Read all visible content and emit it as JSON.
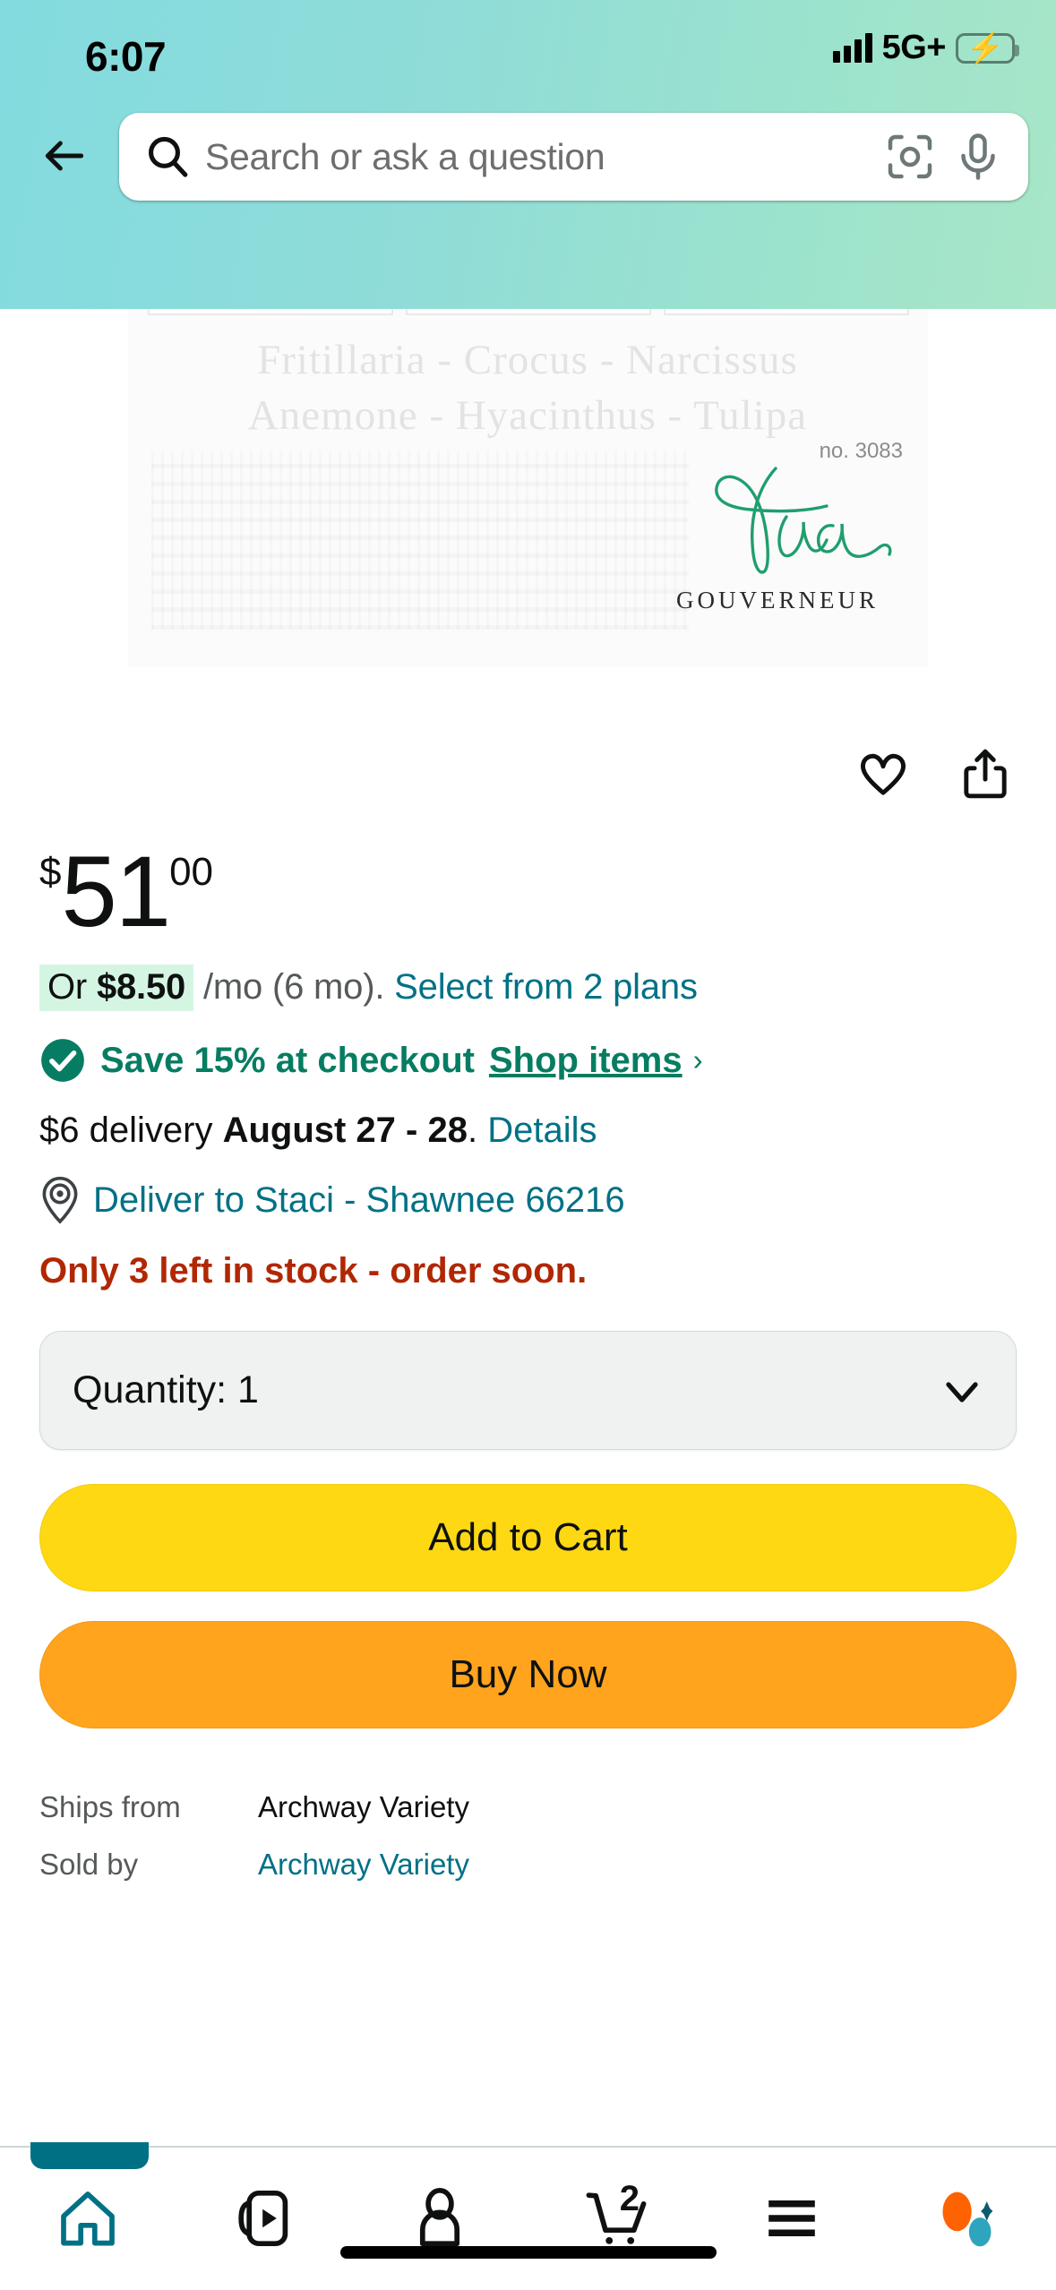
{
  "status_bar": {
    "time": "6:07",
    "network": "5G+",
    "signal_icon": "signal-bars-icon",
    "battery_icon": "battery-charging-icon",
    "battery_color": "#2fd158"
  },
  "header": {
    "background_color": "#8fdcd8",
    "back_icon": "back-arrow-icon",
    "search": {
      "placeholder": "Search or ask a question",
      "search_icon": "search-icon",
      "camera_icon": "camera-lens-icon",
      "mic_icon": "microphone-icon"
    }
  },
  "product_image": {
    "brand_script": "thea",
    "brand_sub": "GOUVERNEUR",
    "item_number": "no. 3083",
    "botanical_line_1": "Fritillaria  -  Crocus  -  Narcissus",
    "botanical_line_2": "Anemone  -  Hyacinthus  -  Tulipa",
    "brand_color": "#1f9e6e"
  },
  "actions": {
    "wishlist_icon": "heart-icon",
    "share_icon": "share-icon"
  },
  "price": {
    "symbol": "$",
    "whole": "51",
    "fraction": "00"
  },
  "installment": {
    "prefix": "Or ",
    "amount": "$8.50",
    "terms": " /mo (6 mo). ",
    "link": "Select from 2 plans",
    "highlight_color": "#d5f5e3",
    "link_color": "#007185"
  },
  "promo": {
    "check_icon": "check-circle-icon",
    "text": "Save 15% at checkout",
    "link": "Shop items",
    "chevron": "›",
    "color": "#067d62"
  },
  "delivery": {
    "prefix": "$6 delivery ",
    "date": "August 27 - 28",
    "suffix": ". ",
    "details_link": "Details"
  },
  "deliver_to": {
    "pin_icon": "location-pin-icon",
    "text": "Deliver to Staci - Shawnee 66216",
    "color": "#007185"
  },
  "stock": {
    "text": "Only 3 left in stock - order soon.",
    "color": "#b12704"
  },
  "quantity": {
    "label": "Quantity:  1",
    "chevron_icon": "chevron-down-icon"
  },
  "buttons": {
    "add_to_cart": "Add to Cart",
    "add_to_cart_color": "#ffd814",
    "buy_now": "Buy Now",
    "buy_now_color": "#ffa41c"
  },
  "seller_info": {
    "rows": [
      {
        "key": "Ships from",
        "value": "Archway Variety",
        "is_link": false
      },
      {
        "key": "Sold by",
        "value": "Archway Variety",
        "is_link": true
      }
    ]
  },
  "bottom_nav": {
    "items": [
      {
        "name": "home",
        "icon": "home-icon",
        "active": true
      },
      {
        "name": "video",
        "icon": "video-shorts-icon",
        "active": false
      },
      {
        "name": "account",
        "icon": "person-icon",
        "active": false
      },
      {
        "name": "cart",
        "icon": "shopping-cart-icon",
        "badge": "2",
        "active": false
      },
      {
        "name": "menu",
        "icon": "hamburger-menu-icon",
        "active": false
      },
      {
        "name": "rufus",
        "icon": "rufus-assistant-icon",
        "active": false
      }
    ],
    "active_color": "#007185",
    "rufus_orange": "#ff6200",
    "rufus_teal": "#2fa5bd"
  }
}
